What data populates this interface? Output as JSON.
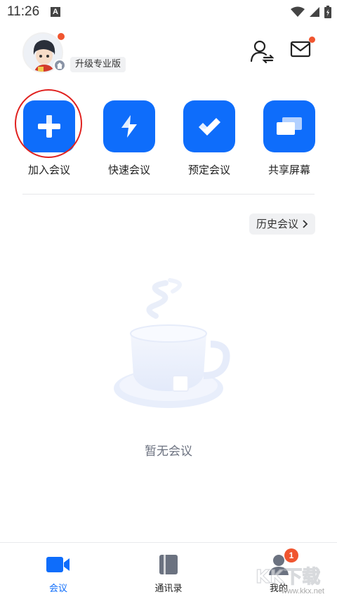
{
  "status_bar": {
    "time": "11:26",
    "notification_letter": "A",
    "icons": [
      "wifi-icon",
      "signal-icon",
      "battery-icon"
    ]
  },
  "header": {
    "upgrade_label": "升级专业版",
    "avatar_notification": true,
    "mail_notification": true
  },
  "actions": [
    {
      "label": "加入会议",
      "icon": "plus-icon"
    },
    {
      "label": "快速会议",
      "icon": "lightning-icon"
    },
    {
      "label": "预定会议",
      "icon": "checkmark-icon"
    },
    {
      "label": "共享屏幕",
      "icon": "share-screen-icon"
    }
  ],
  "history_button": {
    "label": "历史会议",
    "icon": "chevron-right-icon"
  },
  "empty_state": {
    "text": "暂无会议",
    "icon": "coffee-cup-icon"
  },
  "bottom_nav": [
    {
      "label": "会议",
      "icon": "video-camera-icon",
      "active": true
    },
    {
      "label": "通讯录",
      "icon": "address-book-icon",
      "active": false
    },
    {
      "label": "我的",
      "icon": "person-icon",
      "active": false,
      "badge": "1"
    }
  ],
  "watermark": {
    "text": "www.kkx.net",
    "brand": "KK下载"
  },
  "colors": {
    "accent": "#0e6dfb",
    "highlight_ring": "#e0211f",
    "notification": "#f0552f"
  }
}
